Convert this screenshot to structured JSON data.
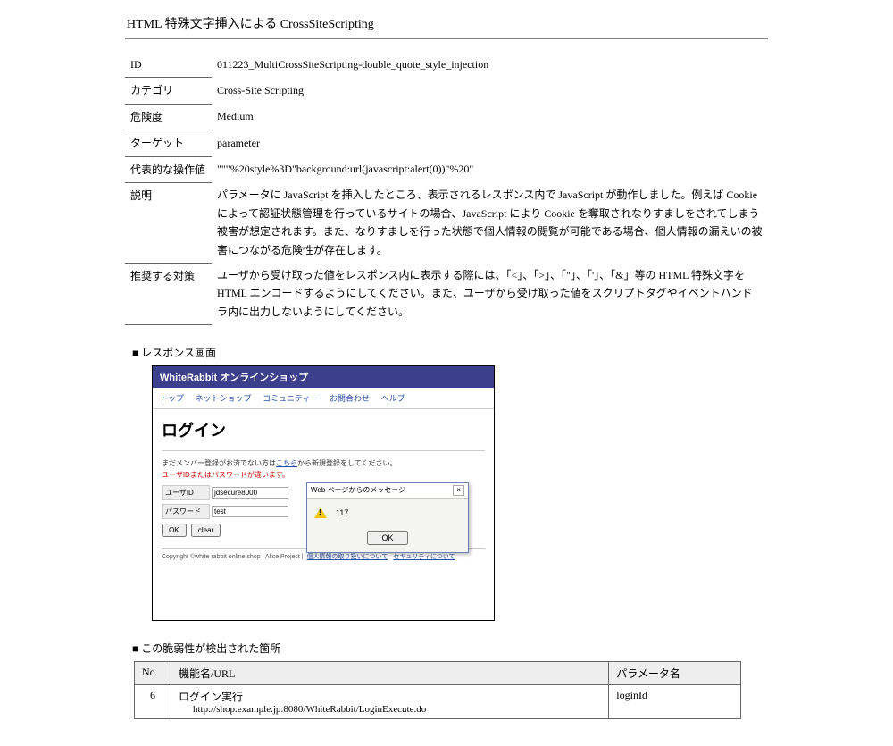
{
  "title": "HTML 特殊文字挿入による CrossSiteScripting",
  "props": {
    "id_label": "ID",
    "id_value": "011223_MultiCrossSiteScripting-double_quote_style_injection",
    "category_label": "カテゴリ",
    "category_value": "Cross-Site Scripting",
    "risk_label": "危険度",
    "risk_value": "Medium",
    "target_label": "ターゲット",
    "target_value": "parameter",
    "sample_label": "代表的な操作値",
    "sample_value": "\"\"\"%20style%3D\"background:url(javascript:alert(0))\"%20\"",
    "desc_label": "説明",
    "desc_value": "パラメータに JavaScript を挿入したところ、表示されるレスポンス内で JavaScript が動作しました。例えば Cookie によって認証状態管理を行っているサイトの場合、JavaScript により Cookie を奪取されなりすましをされてしまう被害が想定されます。また、なりすましを行った状態で個人情報の閲覧が可能である場合、個人情報の漏えいの被害につながる危険性が存在します。",
    "reco_label": "推奨する対策",
    "reco_value": "ユーザから受け取った値をレスポンス内に表示する際には、「<」、「>」、「\"」、「'」、「&」等の HTML 特殊文字を HTML エンコードするようにしてください。また、ユーザから受け取った値をスクリプトタグやイベントハンドラ内に出力しないようにしてください。"
  },
  "response_heading": "レスポンス画面",
  "shot": {
    "titlebar": "WhiteRabbit オンラインショップ",
    "nav": [
      "トップ",
      "ネットショップ",
      "コミュニティー",
      "お問合わせ",
      "ヘルプ"
    ],
    "h1": "ログイン",
    "note_prefix": "まだメンバー登録がお済でない方は",
    "note_link": "こちら",
    "note_suffix": "から新規登録をしてください。",
    "error": "ユーザIDまたはパスワードが違います。",
    "userid_label": "ユーザID",
    "userid_value": "jdsecure8000",
    "password_label": "パスワード",
    "password_value": "test",
    "ok": "OK",
    "clear": "clear",
    "foot_copy": "Copyright ©white rabbit online shop | Alice Project |",
    "foot_link1": "個人情報の取り扱いについて",
    "foot_link2": "セキュリティについて",
    "dlg_title": "Web ページからのメッセージ",
    "dlg_msg": "117",
    "dlg_ok": "OK"
  },
  "vuln_heading": "この脆弱性が検出された箇所",
  "vuln_table": {
    "h_no": "No",
    "h_func": "機能名/URL",
    "h_param": "パラメータ名",
    "row_no": "6",
    "row_func": "ログイン実行",
    "row_url": "http://shop.example.jp:8080/WhiteRabbit/LoginExecute.do",
    "row_param": "loginId"
  }
}
